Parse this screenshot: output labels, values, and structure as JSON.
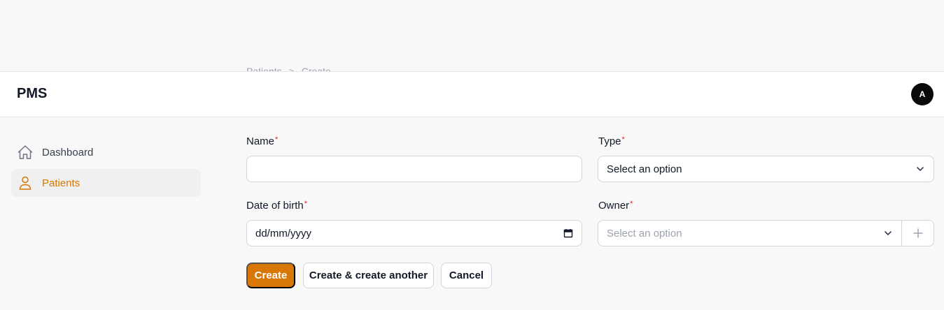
{
  "ghost_breadcrumb": [
    "Patients",
    ">",
    "Create"
  ],
  "app": {
    "title": "PMS",
    "avatar_initial": "A"
  },
  "sidebar": {
    "items": [
      {
        "label": "Dashboard",
        "icon": "home-icon",
        "active": false
      },
      {
        "label": "Patients",
        "icon": "user-icon",
        "active": true
      }
    ]
  },
  "form": {
    "name": {
      "label": "Name",
      "required_mark": "*",
      "value": ""
    },
    "type": {
      "label": "Type",
      "required_mark": "*",
      "value": "Select an option"
    },
    "dob": {
      "label": "Date of birth",
      "required_mark": "*",
      "value": "dd/mm/yyyy"
    },
    "owner": {
      "label": "Owner",
      "required_mark": "*",
      "placeholder": "Select an option"
    }
  },
  "actions": {
    "create": "Create",
    "create_another": "Create & create another",
    "cancel": "Cancel"
  },
  "colors": {
    "accent": "#d97706",
    "required": "#dc2626"
  }
}
